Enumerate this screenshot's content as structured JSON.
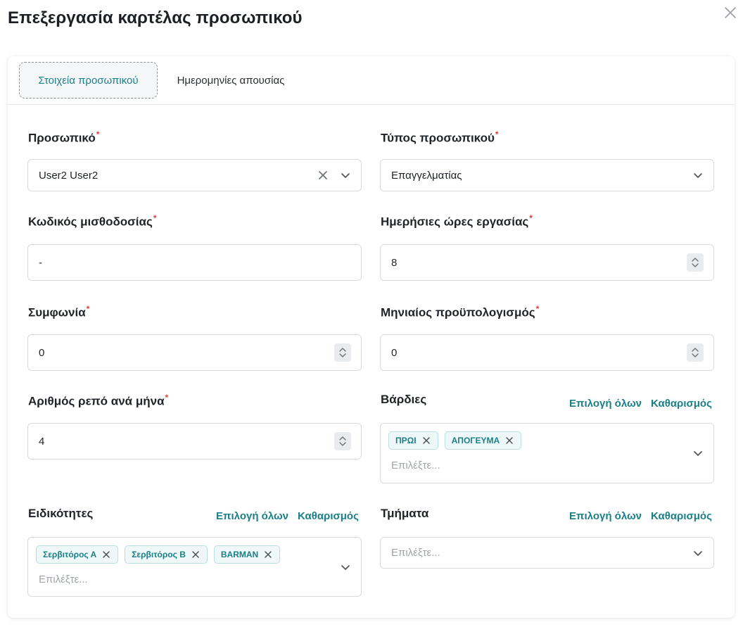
{
  "modal": {
    "title": "Επεξεργασία καρτέλας προσωπικού"
  },
  "tabs": {
    "active": "Στοιχεία προσωπικού",
    "inactive": "Ημερομηνίες απουσίας"
  },
  "required_mark": "*",
  "personnel": {
    "label": "Προσωπικό",
    "value": "User2 User2"
  },
  "personnel_type": {
    "label": "Τύπος προσωπικού",
    "value": "Επαγγελματίας"
  },
  "payroll_code": {
    "label": "Κωδικός μισθοδοσίας",
    "value": "-"
  },
  "daily_hours": {
    "label": "Ημερήσιες ώρες εργασίας",
    "value": "8"
  },
  "agreement": {
    "label": "Συμφωνία",
    "value": "0"
  },
  "monthly_budget": {
    "label": "Μηνιαίος προϋπολογισμός",
    "value": "0"
  },
  "days_off": {
    "label": "Αριθμός ρεπό ανά μήνα",
    "value": "4"
  },
  "shifts": {
    "label": "Βάρδιες",
    "select_all": "Επιλογή όλων",
    "clear": "Καθαρισμός",
    "chips": [
      "ΠΡΩΙ",
      "ΑΠΟΓΕΥΜΑ"
    ],
    "placeholder": "Επιλέξτε..."
  },
  "specialties": {
    "label": "Ειδικότητες",
    "select_all": "Επιλογή όλων",
    "clear": "Καθαρισμός",
    "chips": [
      "Σερβιτόρος Α",
      "Σερβιτόρος Β",
      "BARMAN"
    ],
    "placeholder": "Επιλέξτε..."
  },
  "departments": {
    "label": "Τμήματα",
    "select_all": "Επιλογή όλων",
    "clear": "Καθαρισμός",
    "placeholder": "Επιλέξτε..."
  },
  "colors": {
    "accent": "#1a7f86",
    "required": "#e23b3b",
    "border": "#d7dbe0"
  }
}
